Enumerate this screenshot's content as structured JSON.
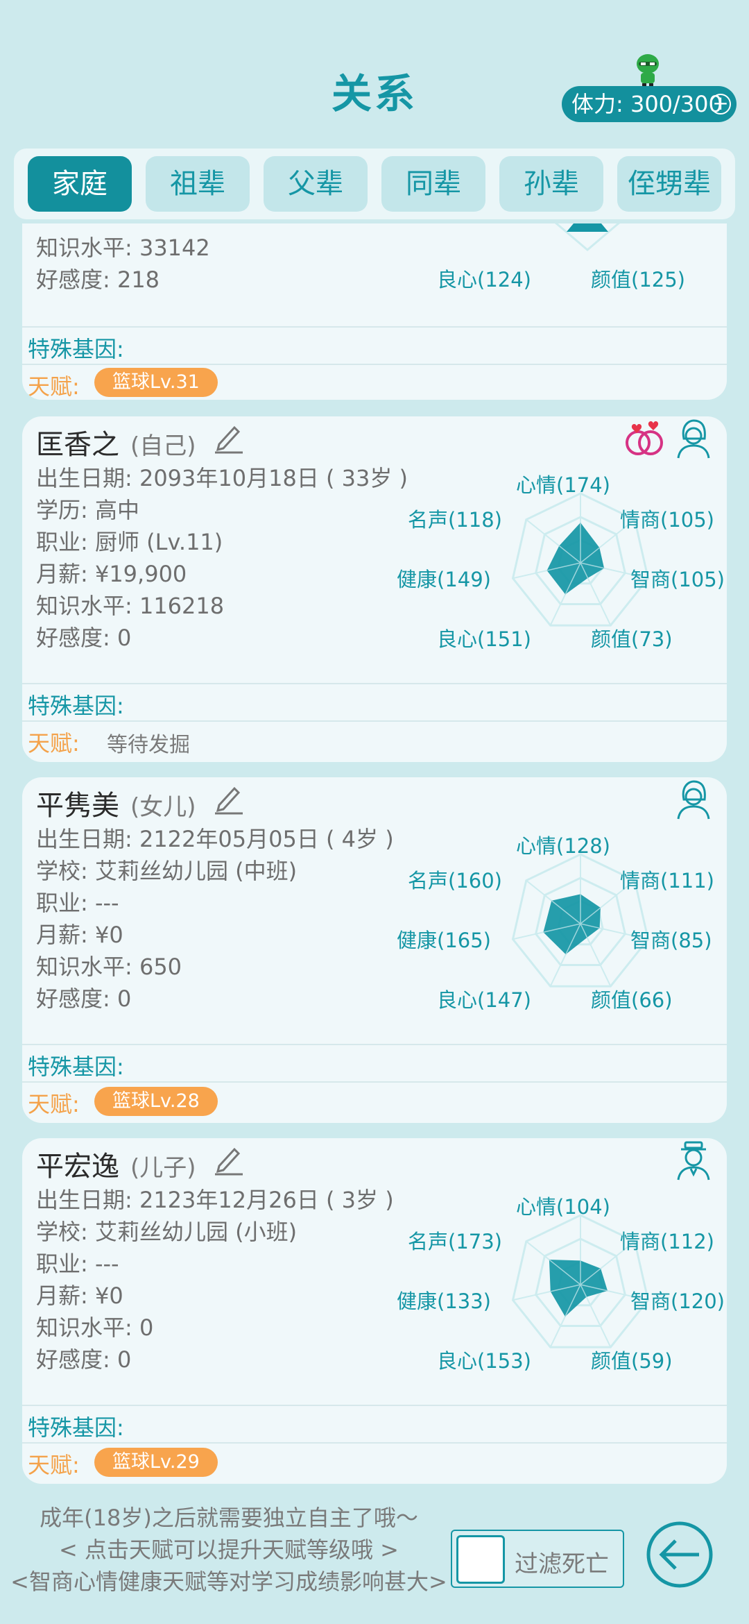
{
  "header": {
    "title": "关系",
    "stamina": "体力: 300/300",
    "plus": "+"
  },
  "tabs": [
    {
      "label": "家庭",
      "active": true
    },
    {
      "label": "祖辈",
      "active": false
    },
    {
      "label": "父辈",
      "active": false
    },
    {
      "label": "同辈",
      "active": false
    },
    {
      "label": "孙辈",
      "active": false
    },
    {
      "label": "侄甥辈",
      "active": false
    }
  ],
  "cards": [
    {
      "partial": true,
      "info": [
        "知识水平: 33142",
        "好感度: 218"
      ],
      "radar_labels": {
        "good": "良心(124)",
        "look": "颜值(125)"
      },
      "gene_label": "特殊基因:",
      "talent_label": "天赋:",
      "talent": "篮球Lv.31"
    },
    {
      "name": "匡香之",
      "relation": "(自己)",
      "info": [
        "出生日期: 2093年10月18日 ( 33岁 )",
        "学历: 高中",
        "职业: 厨师 (Lv.11)",
        "月薪: ¥19,900",
        "知识水平: 116218",
        "好感度: 0"
      ],
      "radar_labels": {
        "mood": "心情(174)",
        "eq": "情商(105)",
        "iq": "智商(105)",
        "look": "颜值(73)",
        "good": "良心(151)",
        "health": "健康(149)",
        "fame": "名声(118)"
      },
      "stats": [
        174,
        105,
        105,
        73,
        151,
        149,
        118
      ],
      "gene_label": "特殊基因:",
      "talent_label": "天赋:",
      "talent": "等待发掘"
    },
    {
      "name": "平隽美",
      "relation": "(女儿)",
      "info": [
        "出生日期: 2122年05月05日 ( 4岁 )",
        "学校: 艾莉丝幼儿园 (中班)",
        "职业: ---",
        "月薪: ¥0",
        "知识水平: 650",
        "好感度: 0"
      ],
      "radar_labels": {
        "mood": "心情(128)",
        "eq": "情商(111)",
        "iq": "智商(85)",
        "look": "颜值(66)",
        "good": "良心(147)",
        "health": "健康(165)",
        "fame": "名声(160)"
      },
      "stats": [
        128,
        111,
        85,
        66,
        147,
        165,
        160
      ],
      "gene_label": "特殊基因:",
      "talent_label": "天赋:",
      "talent": "篮球Lv.28"
    },
    {
      "name": "平宏逸",
      "relation": "(儿子)",
      "info": [
        "出生日期: 2123年12月26日 ( 3岁 )",
        "学校: 艾莉丝幼儿园 (小班)",
        "职业: ---",
        "月薪: ¥0",
        "知识水平: 0",
        "好感度: 0"
      ],
      "radar_labels": {
        "mood": "心情(104)",
        "eq": "情商(112)",
        "iq": "智商(120)",
        "look": "颜值(59)",
        "good": "良心(153)",
        "health": "健康(133)",
        "fame": "名声(173)"
      },
      "stats": [
        104,
        112,
        120,
        59,
        153,
        133,
        173
      ],
      "gene_label": "特殊基因:",
      "talent_label": "天赋:",
      "talent": "篮球Lv.29"
    }
  ],
  "footer": {
    "tip1": "成年(18岁)之后就需要独立自主了哦～",
    "tip2": "< 点击天赋可以提升天赋等级哦 >",
    "tip3": "<智商心情健康天赋等对学习成绩影响甚大>",
    "filter_label": "过滤死亡"
  },
  "colors": {
    "accent": "#1596a5",
    "talent": "#f8a44d",
    "background": "#cdeaed"
  }
}
